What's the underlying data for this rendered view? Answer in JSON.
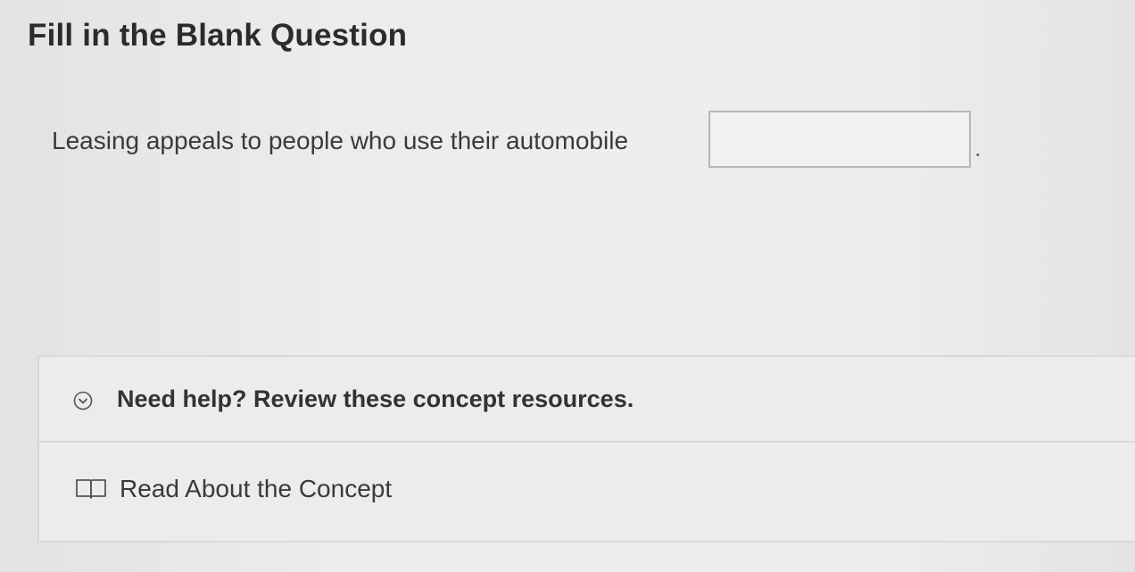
{
  "page": {
    "title": "Fill in the Blank Question"
  },
  "question": {
    "text": "Leasing appeals to people who use their automobile",
    "blank_value": "",
    "trailing_punctuation": "."
  },
  "help": {
    "title": "Need help? Review these concept resources.",
    "expand_icon": "chevron-down-icon",
    "resources": [
      {
        "label": "Read About the Concept",
        "icon": "book-icon"
      }
    ]
  }
}
